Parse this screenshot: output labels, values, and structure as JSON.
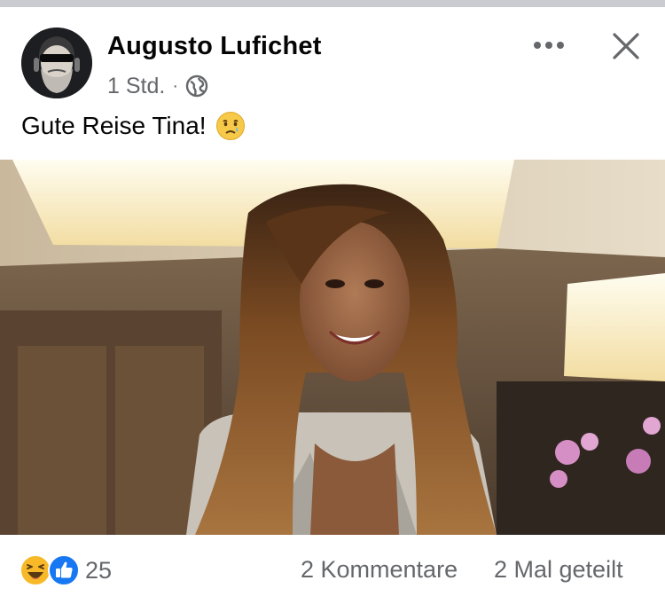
{
  "post": {
    "author": "Augusto Lufichet",
    "time": "1 Std.",
    "separator": "·",
    "visibility_icon": "globe-icon",
    "text": "Gute Reise Tina!",
    "text_emoji": "crying-face-emoji"
  },
  "header_actions": {
    "more_icon": "more-icon",
    "close_icon": "close-icon"
  },
  "footer": {
    "reaction_icons": [
      "haha-reaction-icon",
      "like-reaction-icon"
    ],
    "reaction_count": "25",
    "comments": "2 Kommentare",
    "shares": "2 Mal geteilt"
  },
  "colors": {
    "text_primary": "#050505",
    "text_secondary": "#65676b",
    "like_blue": "#1877f2",
    "haha_yellow": "#f7b928"
  }
}
